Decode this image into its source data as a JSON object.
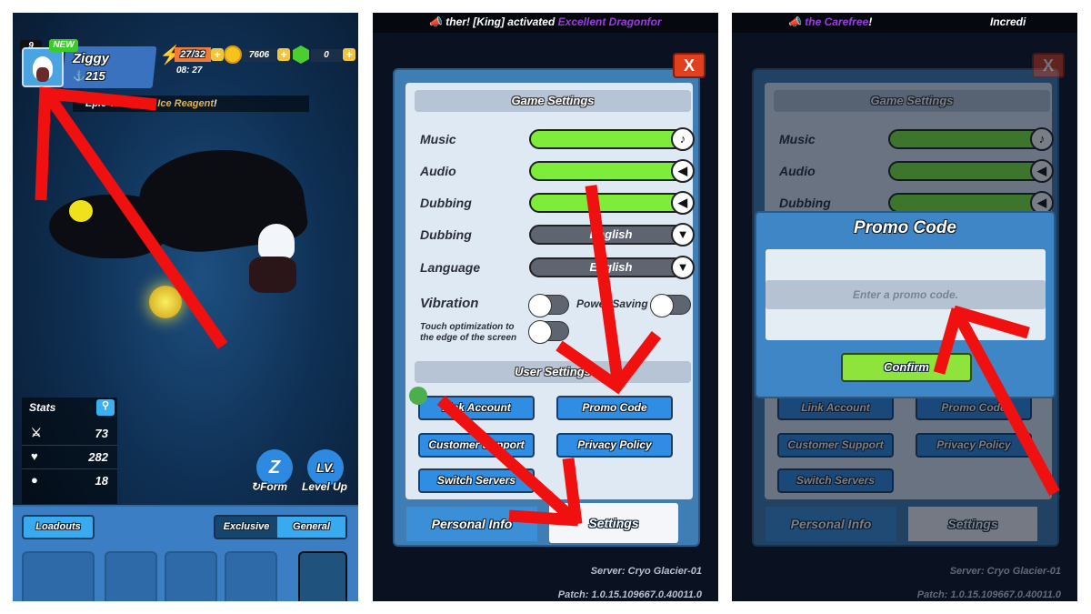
{
  "panel1": {
    "level": "9",
    "new_badge": "NEW",
    "player_name": "Ziggy",
    "power": "215",
    "energy": "27/32",
    "energy_timer": "08: 27",
    "coins": "7606",
    "gems": "0",
    "plus": "+",
    "treasure_prefix": "Epic Treasure: ",
    "treasure_item": "Ice Reagent",
    "treasure_suffix": "!",
    "stats": {
      "title": "Stats",
      "rows": [
        {
          "icon": "attack-icon",
          "value": "73"
        },
        {
          "icon": "heart-icon",
          "value": "282"
        },
        {
          "icon": "defense-icon",
          "value": "18"
        }
      ]
    },
    "form_label": "Form",
    "level_up_label": "Level Up",
    "level_up_icon_text": "LV.",
    "loadouts_label": "Loadouts",
    "exclusive_label": "Exclusive",
    "general_label": "General"
  },
  "panel2": {
    "banner_text": "ther! [King] activated ",
    "banner_highlight": "Excellent Dragonfor",
    "close_label": "X",
    "game_settings_title": "Game Settings",
    "music_label": "Music",
    "audio_label": "Audio",
    "dubbing_volume_label": "Dubbing",
    "dubbing_language_label": "Dubbing",
    "dubbing_language_value": "English",
    "language_label": "Language",
    "language_value": "English",
    "vibration_label": "Vibration",
    "power_saving_label": "Power Saving",
    "touch_optimization_label": "Touch optimization to the edge of the screen",
    "music_level": 100,
    "audio_level": 100,
    "dubbing_level": 100,
    "vibration_on": false,
    "power_saving_on": false,
    "touch_optimization_on": false,
    "user_settings_title": "User Settings",
    "buttons": {
      "link_account": "Link Account",
      "promo_code": "Promo Code",
      "customer_support": "Customer Support",
      "privacy_policy": "Privacy Policy",
      "switch_servers": "Switch Servers"
    },
    "tab_personal_info": "Personal Info",
    "tab_settings": "Settings",
    "server": "Server: Cryo Glacier-01",
    "patch": "Patch: 1.0.15.109667.0.40011.0"
  },
  "panel3": {
    "banner_highlight": "the Carefree",
    "banner_suffix": "!",
    "banner_right": "Incredi",
    "promo_title": "Promo Code",
    "promo_placeholder": "Enter a promo code.",
    "confirm_label": "Confirm"
  },
  "colors": {
    "arrow": "#f01010",
    "slider_green": "#7ded3a",
    "button_blue": "#2f8de4",
    "highlight_purple": "#9a3ce0"
  }
}
